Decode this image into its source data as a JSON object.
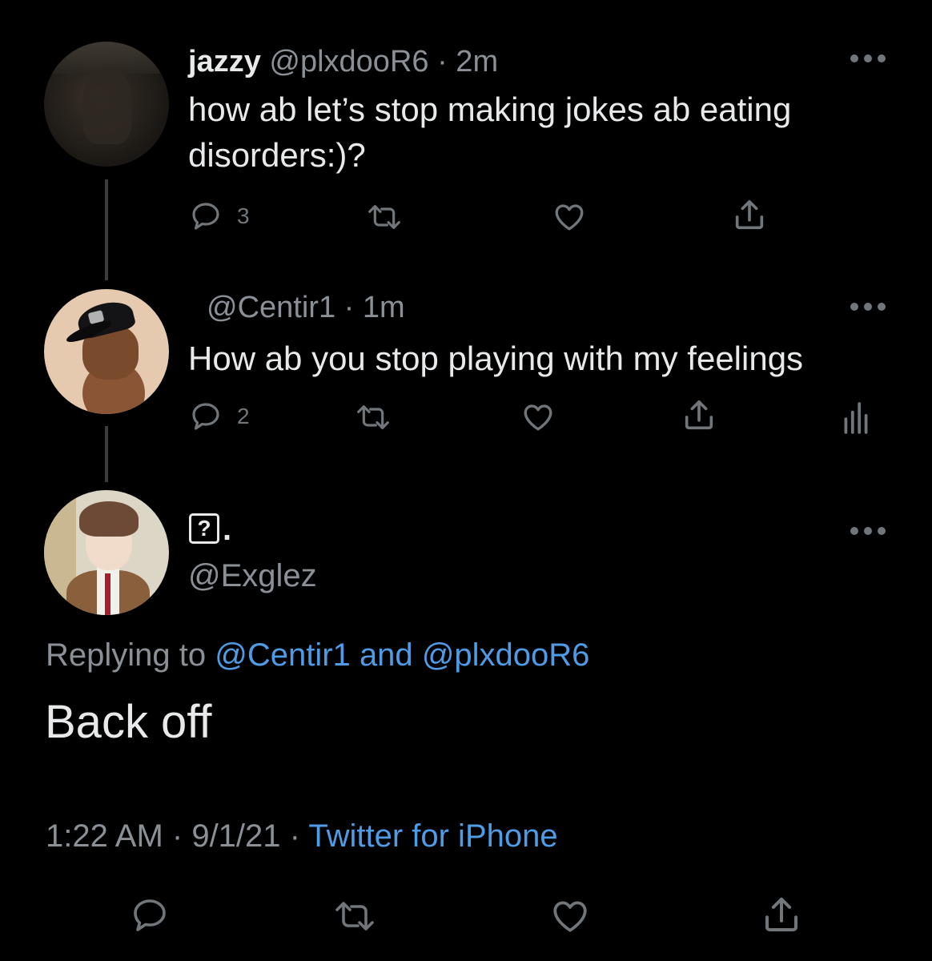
{
  "tweet1": {
    "display_name": "jazzy",
    "handle": "@plxdooR6",
    "time": "· 2m",
    "text_line1": "how ab let’s stop making jokes ab eating",
    "text_line2": "disorders:)?",
    "reply_count": "3"
  },
  "tweet2": {
    "handle": "@Centir1",
    "time": "· 1m",
    "text": "How ab you stop playing with my feelings",
    "reply_count": "2"
  },
  "main_tweet": {
    "display_name": "?",
    "name_suffix": ".",
    "handle": "@Exglez",
    "replying_prefix": "Replying to",
    "replying_user1": "@Centir1",
    "replying_and": "and",
    "replying_user2": "@plxdooR6",
    "text": "Back off",
    "time": "1:22 AM",
    "date": "· 9/1/21 ·",
    "source": "Twitter for iPhone"
  },
  "icons": {
    "reply": "reply-icon",
    "retweet": "retweet-icon",
    "like": "heart-icon",
    "share": "share-icon",
    "analytics": "analytics-icon",
    "more": "more-dots-icon"
  },
  "colors": {
    "background": "#000000",
    "text": "#e7e9ea",
    "muted": "#8b9097",
    "link": "#4f9be5",
    "thread_line": "#3a3d40"
  }
}
